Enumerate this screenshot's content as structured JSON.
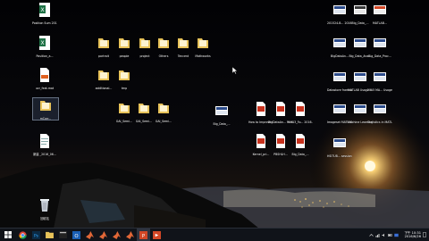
{
  "desktop": {
    "icons": [
      {
        "label": "Position Sum 201...",
        "type": "excel"
      },
      {
        "label": "Position_a...",
        "type": "excel"
      },
      {
        "label": "ucr_feat.mat",
        "type": "file"
      },
      {
        "label": "mCorr...",
        "type": "folder"
      },
      {
        "label": "新建 _2016_06...",
        "type": "doc"
      },
      {
        "label": "回收站",
        "type": "recycle"
      },
      {
        "label": "portrait",
        "type": "folder"
      },
      {
        "label": "people",
        "type": "folder"
      },
      {
        "label": "project",
        "type": "folder"
      },
      {
        "label": "Others",
        "type": "folder"
      },
      {
        "label": "Tencent",
        "type": "folder"
      },
      {
        "label": "Mathworks",
        "type": "folder"
      },
      {
        "label": "additional...",
        "type": "folder"
      },
      {
        "label": "tmp",
        "type": "folder"
      },
      {
        "label": "GAI_Semi...",
        "type": "folder"
      },
      {
        "label": "GAI_Semi...",
        "type": "folder"
      },
      {
        "label": "GAI_Semi...",
        "type": "folder"
      },
      {
        "label": "Big_Data_...",
        "type": "pptimg"
      },
      {
        "label": "How to Improve I...",
        "type": "pdf"
      },
      {
        "label": "BigDataAn... Mining...",
        "type": "pdf"
      },
      {
        "label": "9.913_Fo... 2016...",
        "type": "pdf"
      },
      {
        "label": "Kernel_pri...",
        "type": "pdf"
      },
      {
        "label": "PBSHLH...",
        "type": "pdf"
      },
      {
        "label": "Big_Data_...",
        "type": "pdf"
      },
      {
        "label": "201524-B... 2016 Re...",
        "type": "pptimg"
      },
      {
        "label": "Big_Data_...",
        "type": "pptimg"
      },
      {
        "label": "MATLAB...",
        "type": "pptimg"
      },
      {
        "label": "BigDataAn...",
        "type": "pptimg"
      },
      {
        "label": "Big_Data_Ana...",
        "type": "pptimg"
      },
      {
        "label": "Big_Data_Proc...",
        "type": "pptimg"
      },
      {
        "label": "Datastore framework...",
        "type": "pptimg"
      },
      {
        "label": "MATLAB Usage in F...",
        "type": "pptimg"
      },
      {
        "label": "2015 MA... Usage...",
        "type": "pptimg"
      },
      {
        "label": "Imageset MATLAB...",
        "type": "pptimg"
      },
      {
        "label": "Machine Learning...",
        "type": "pptimg"
      },
      {
        "label": "Statistics in MATLAB...",
        "type": "pptimg"
      },
      {
        "label": "HSITUB... session...",
        "type": "pptimg"
      }
    ]
  },
  "taskbar": {
    "apps": [
      "start",
      "chrome",
      "photoshop",
      "explorer",
      "terminal",
      "outlook",
      "matlab",
      "matlab",
      "matlab",
      "matlab",
      "powerpoint",
      "powerpoint2"
    ],
    "clock_time": "下午 10:31",
    "clock_date": "2016/6/26"
  },
  "colors": {
    "taskbar": "#101319",
    "folder": "#e8c35a",
    "excel": "#1e7145",
    "pdf": "#c8321e",
    "ppt": "#d24726"
  }
}
